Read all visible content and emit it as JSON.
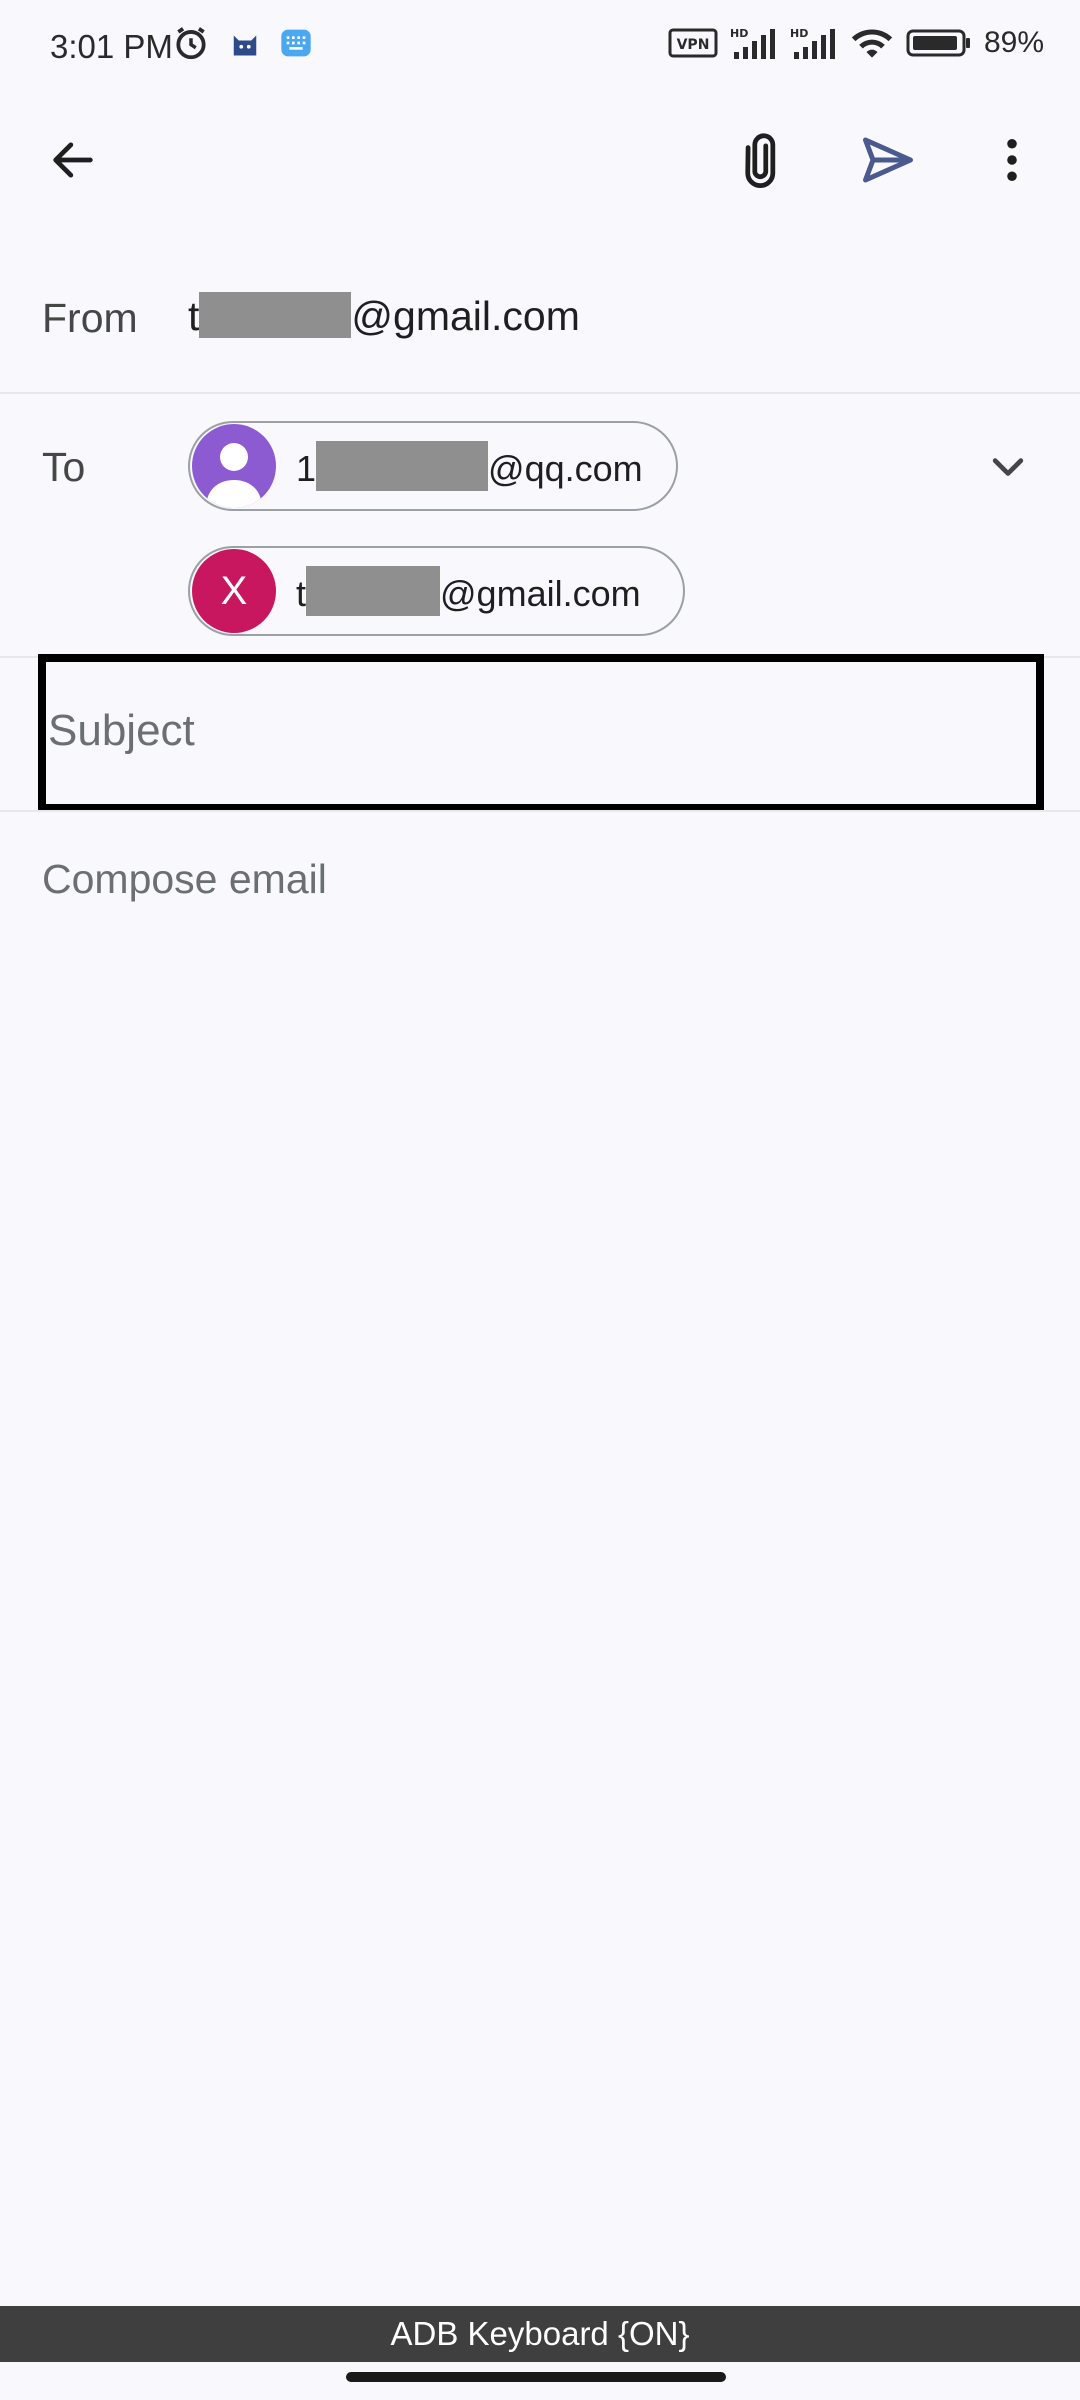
{
  "status_bar": {
    "time": "3:01 PM",
    "left_icons": [
      "alarm-icon",
      "cat-app-icon",
      "keyboard-app-icon"
    ],
    "right_icons": [
      "vpn-icon",
      "signal-hd-icon",
      "signal-hd-icon",
      "wifi-icon",
      "battery-icon"
    ],
    "battery_percent": "89%"
  },
  "app_bar": {
    "back_icon": "arrow-back-icon",
    "actions": [
      "paperclip-icon",
      "send-icon",
      "more-vert-icon"
    ]
  },
  "from": {
    "label": "From",
    "value_prefix": "t",
    "value_suffix": "@gmail.com"
  },
  "to": {
    "label": "To",
    "recipients": [
      {
        "prefix": "1",
        "suffix": "@qq.com",
        "avatar": "person-icon",
        "avatar_color": "#8c5bd2"
      },
      {
        "prefix": "t",
        "suffix": "@gmail.com",
        "avatar_letter": "X",
        "avatar_color": "#c8175f"
      }
    ],
    "expand_icon": "chevron-down-icon"
  },
  "subject": {
    "placeholder": "Subject",
    "value": ""
  },
  "body": {
    "placeholder": "Compose email",
    "value": ""
  },
  "keyboard_bar": {
    "text": "ADB Keyboard {ON}"
  },
  "colors": {
    "background": "#f8f8fd",
    "send_accent": "#4a5a8f",
    "focus_border": "#000000"
  }
}
